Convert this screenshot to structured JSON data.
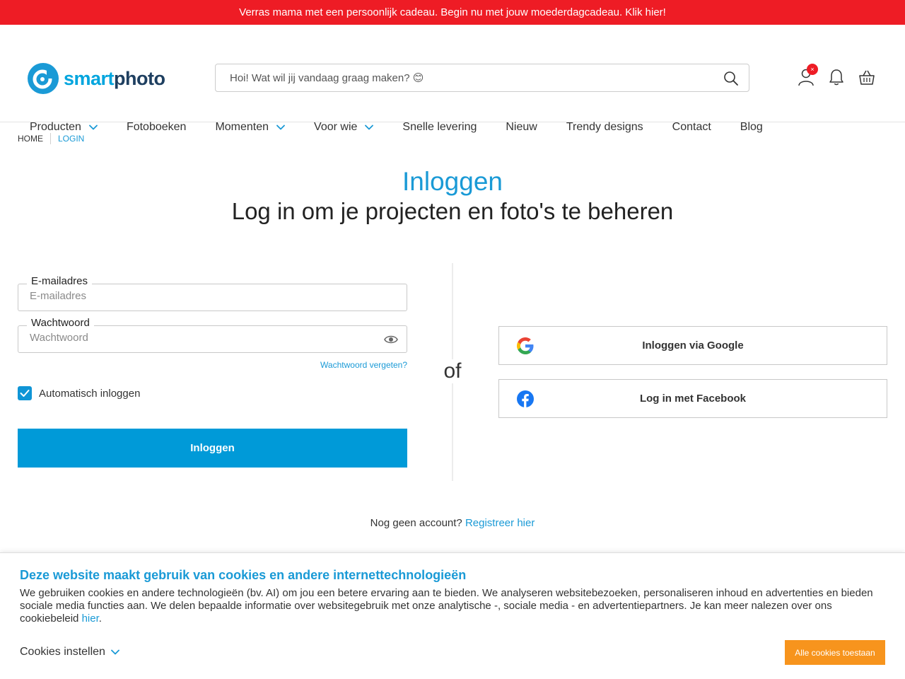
{
  "promo": {
    "text": "Verras mama met een persoonlijk cadeau. Begin nu met jouw moederdagcadeau. Klik hier!"
  },
  "header": {
    "logo_text_a": "smart",
    "logo_text_b": "photo",
    "search_placeholder": "Hoi! Wat wil jij vandaag graag maken? 😊",
    "account_badge": "×",
    "icons": [
      "user-icon",
      "bell-icon",
      "basket-icon",
      "search-icon"
    ]
  },
  "nav": {
    "items": [
      {
        "label": "Producten",
        "dropdown": true
      },
      {
        "label": "Fotoboeken",
        "dropdown": false
      },
      {
        "label": "Momenten",
        "dropdown": true
      },
      {
        "label": "Voor wie",
        "dropdown": true
      },
      {
        "label": "Snelle levering",
        "dropdown": false
      },
      {
        "label": "Nieuw",
        "dropdown": false
      },
      {
        "label": "Trendy designs",
        "dropdown": false
      },
      {
        "label": "Contact",
        "dropdown": false
      },
      {
        "label": "Blog",
        "dropdown": false
      }
    ]
  },
  "breadcrumb": {
    "home": "HOME",
    "current": "LOGIN"
  },
  "page": {
    "title": "Inloggen",
    "subtitle": "Log in om je projecten en foto's te beheren"
  },
  "form": {
    "email_label": "E-mailadres",
    "email_placeholder": "E-mailadres",
    "email_value": "",
    "password_label": "Wachtwoord",
    "password_placeholder": "Wachtwoord",
    "password_value": "",
    "forgot_link": "Wachtwoord vergeten?",
    "remember_label": "Automatisch inloggen",
    "remember_checked": true,
    "submit_label": "Inloggen"
  },
  "divider_label": "of",
  "social": {
    "google_label": "Inloggen via Google",
    "facebook_label": "Log in met Facebook"
  },
  "register": {
    "question": "Nog geen account?",
    "link": "Registreer hier"
  },
  "cookie": {
    "title": "Deze website maakt gebruik van cookies en andere internettechnologieën",
    "text": "We gebruiken cookies en andere technologieën (bv. AI) om jou een betere ervaring aan te bieden. We analyseren websitebezoeken, personaliseren inhoud en advertenties en bieden sociale media functies aan. We delen bepaalde informatie over websitegebruik met onze analytische -, sociale media - en advertentiepartners. Je kan meer nalezen over ons cookiebeleid",
    "link": "hier",
    "after_link": ".",
    "settings_label": "Cookies instellen",
    "accept_label": "Alle cookies toestaan"
  },
  "colors": {
    "promo_bg": "#ee1c25",
    "brand_blue": "#1a9ad6",
    "button_blue": "#009ad8",
    "accept_orange": "#f7941d",
    "logo_dark": "#1e3f60"
  }
}
